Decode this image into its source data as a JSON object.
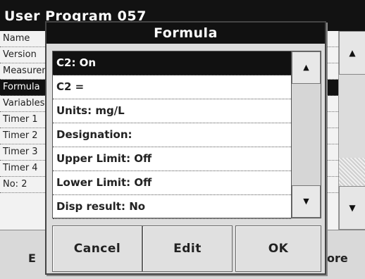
{
  "background": {
    "title": "User Program    057",
    "rows": [
      "Name",
      "Version",
      "Measurement",
      "Formula",
      "Variables",
      "Timer 1",
      "Timer 2",
      "Timer 3",
      "Timer 4",
      "No: 2"
    ],
    "selected_row_index": 3,
    "scroll_up_icon": "arrow-up-icon",
    "scroll_down_icon": "arrow-down-icon",
    "bottom_left_label": "E",
    "bottom_right_label": "ore"
  },
  "dialog": {
    "title": "Formula",
    "items": [
      {
        "label": "C2: On"
      },
      {
        "label": "C2 ="
      },
      {
        "label": "Units: mg/L"
      },
      {
        "label": "Designation:"
      },
      {
        "label": "Upper Limit: Off"
      },
      {
        "label": "Lower Limit: Off"
      },
      {
        "label": "Disp result: No"
      }
    ],
    "selected_index": 0,
    "scroll_up_glyph": "▲",
    "scroll_down_glyph": "▼",
    "buttons": {
      "cancel": "Cancel",
      "edit": "Edit",
      "ok": "OK"
    }
  }
}
